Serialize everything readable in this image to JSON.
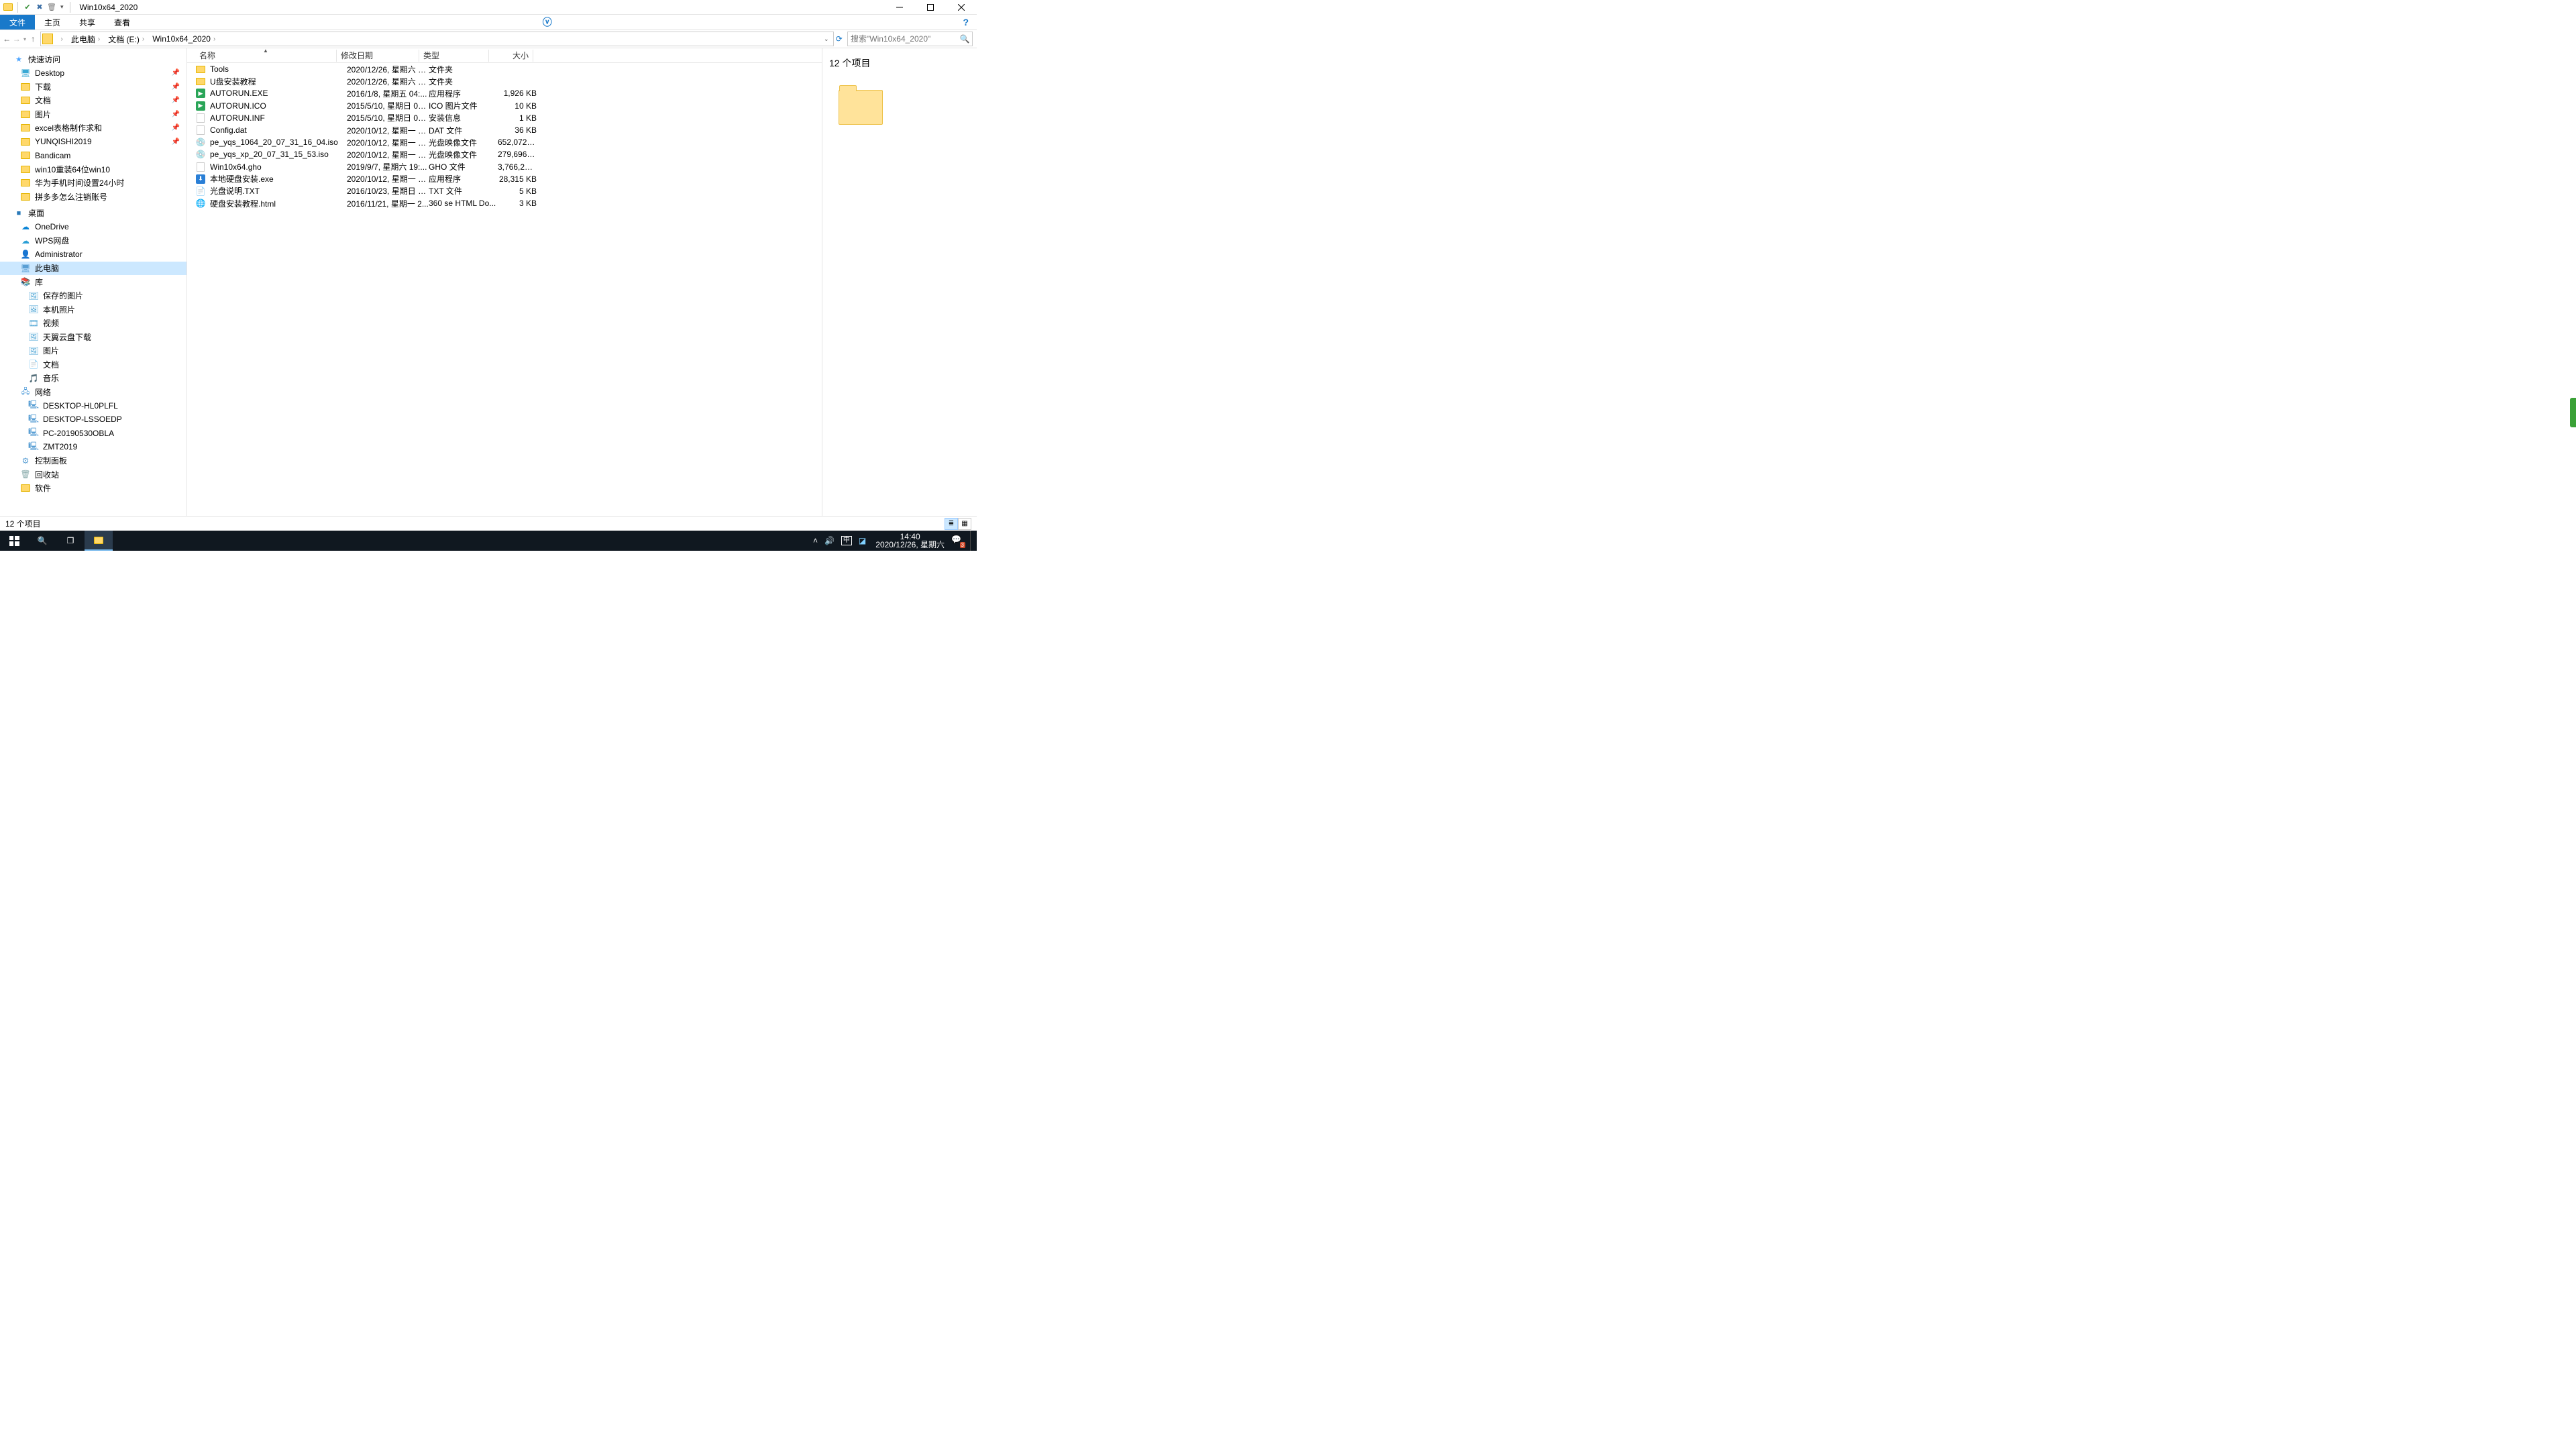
{
  "window": {
    "title": "Win10x64_2020"
  },
  "ribbon": {
    "file": "文件",
    "tabs": [
      "主页",
      "共享",
      "查看"
    ]
  },
  "breadcrumbs": [
    "此电脑",
    "文档 (E:)",
    "Win10x64_2020"
  ],
  "search": {
    "placeholder": "搜索\"Win10x64_2020\""
  },
  "columns": {
    "name": "名称",
    "date": "修改日期",
    "type": "类型",
    "size": "大小"
  },
  "nav": {
    "quick": {
      "label": "快速访问",
      "items": [
        {
          "label": "Desktop",
          "pin": true,
          "ico": "desktop"
        },
        {
          "label": "下载",
          "pin": true,
          "ico": "folder"
        },
        {
          "label": "文档",
          "pin": true,
          "ico": "folder"
        },
        {
          "label": "图片",
          "pin": true,
          "ico": "folder"
        },
        {
          "label": "excel表格制作求和",
          "pin": true,
          "ico": "folder"
        },
        {
          "label": "YUNQISHI2019",
          "pin": true,
          "ico": "folder"
        },
        {
          "label": "Bandicam",
          "pin": false,
          "ico": "folder"
        },
        {
          "label": "win10重装64位win10",
          "pin": false,
          "ico": "folder"
        },
        {
          "label": "华为手机时间设置24小时",
          "pin": false,
          "ico": "folder"
        },
        {
          "label": "拼多多怎么注销账号",
          "pin": false,
          "ico": "folder"
        }
      ]
    },
    "desktop": {
      "label": "桌面",
      "items": [
        {
          "label": "OneDrive",
          "ico": "cloud-blue"
        },
        {
          "label": "WPS网盘",
          "ico": "cloud-orange"
        },
        {
          "label": "Administrator",
          "ico": "user"
        },
        {
          "label": "此电脑",
          "ico": "pc",
          "sel": true
        },
        {
          "label": "库",
          "ico": "lib"
        }
      ]
    },
    "libs": [
      {
        "label": "保存的图片",
        "ico": "pic"
      },
      {
        "label": "本机照片",
        "ico": "pic"
      },
      {
        "label": "视频",
        "ico": "vid"
      },
      {
        "label": "天翼云盘下载",
        "ico": "pic"
      },
      {
        "label": "图片",
        "ico": "pic"
      },
      {
        "label": "文档",
        "ico": "doc"
      },
      {
        "label": "音乐",
        "ico": "mus"
      }
    ],
    "network": {
      "label": "网络",
      "items": [
        {
          "label": "DESKTOP-HL0PLFL",
          "ico": "netpc"
        },
        {
          "label": "DESKTOP-LSSOEDP",
          "ico": "netpc"
        },
        {
          "label": "PC-20190530OBLA",
          "ico": "netpc"
        },
        {
          "label": "ZMT2019",
          "ico": "netpc"
        }
      ]
    },
    "extra": [
      {
        "label": "控制面板",
        "ico": "cp"
      },
      {
        "label": "回收站",
        "ico": "bin"
      },
      {
        "label": "软件",
        "ico": "folder"
      }
    ]
  },
  "files": [
    {
      "ico": "folder",
      "name": "Tools",
      "date": "2020/12/26, 星期六 1...",
      "type": "文件夹",
      "size": ""
    },
    {
      "ico": "folder",
      "name": "U盘安装教程",
      "date": "2020/12/26, 星期六 1...",
      "type": "文件夹",
      "size": ""
    },
    {
      "ico": "exe-g",
      "name": "AUTORUN.EXE",
      "date": "2016/1/8, 星期五 04:...",
      "type": "应用程序",
      "size": "1,926 KB"
    },
    {
      "ico": "icofile",
      "name": "AUTORUN.ICO",
      "date": "2015/5/10, 星期日 02...",
      "type": "ICO 图片文件",
      "size": "10 KB"
    },
    {
      "ico": "inf",
      "name": "AUTORUN.INF",
      "date": "2015/5/10, 星期日 02...",
      "type": "安装信息",
      "size": "1 KB"
    },
    {
      "ico": "dat",
      "name": "Config.dat",
      "date": "2020/10/12, 星期一 1...",
      "type": "DAT 文件",
      "size": "36 KB"
    },
    {
      "ico": "iso",
      "name": "pe_yqs_1064_20_07_31_16_04.iso",
      "date": "2020/10/12, 星期一 1...",
      "type": "光盘映像文件",
      "size": "652,072 KB"
    },
    {
      "ico": "iso",
      "name": "pe_yqs_xp_20_07_31_15_53.iso",
      "date": "2020/10/12, 星期一 1...",
      "type": "光盘映像文件",
      "size": "279,696 KB"
    },
    {
      "ico": "gho",
      "name": "Win10x64.gho",
      "date": "2019/9/7, 星期六 19:...",
      "type": "GHO 文件",
      "size": "3,766,272..."
    },
    {
      "ico": "exe-b",
      "name": "本地硬盘安装.exe",
      "date": "2020/10/12, 星期一 1...",
      "type": "应用程序",
      "size": "28,315 KB"
    },
    {
      "ico": "txt",
      "name": "光盘说明.TXT",
      "date": "2016/10/23, 星期日 0...",
      "type": "TXT 文件",
      "size": "5 KB"
    },
    {
      "ico": "html",
      "name": "硬盘安装教程.html",
      "date": "2016/11/21, 星期一 2...",
      "type": "360 se HTML Do...",
      "size": "3 KB"
    }
  ],
  "preview": {
    "title": "12 个项目"
  },
  "status": {
    "text": "12 个项目"
  },
  "tray": {
    "time": "14:40",
    "date": "2020/12/26, 星期六",
    "ime": "中",
    "badge": "3"
  }
}
